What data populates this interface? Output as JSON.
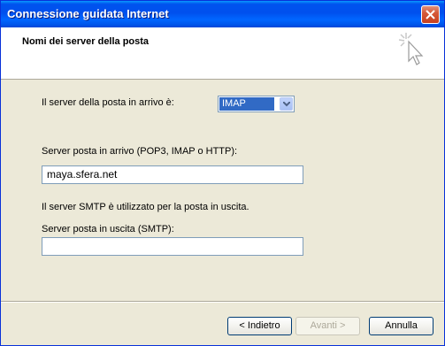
{
  "window": {
    "title": "Connessione guidata Internet"
  },
  "header": {
    "title": "Nomi dei server della posta"
  },
  "form": {
    "incoming_type_label": "Il server della posta in arrivo è:",
    "incoming_type_value": "IMAP",
    "incoming_server_label": "Server posta in arrivo (POP3, IMAP o HTTP):",
    "incoming_server_value": "maya.sfera.net",
    "smtp_note": "Il server SMTP è utilizzato per la posta in uscita.",
    "outgoing_server_label": "Server posta in uscita (SMTP):",
    "outgoing_server_value": ""
  },
  "buttons": {
    "back": "< Indietro",
    "next": "Avanti >",
    "cancel": "Annulla"
  },
  "icons": {
    "close": "close-icon",
    "wizard": "cursor-sparkle-icon",
    "dropdown": "chevron-down-icon"
  },
  "colors": {
    "titlebar": "#0054e3",
    "selection": "#316ac5",
    "dialog_bg": "#ece9d8"
  }
}
